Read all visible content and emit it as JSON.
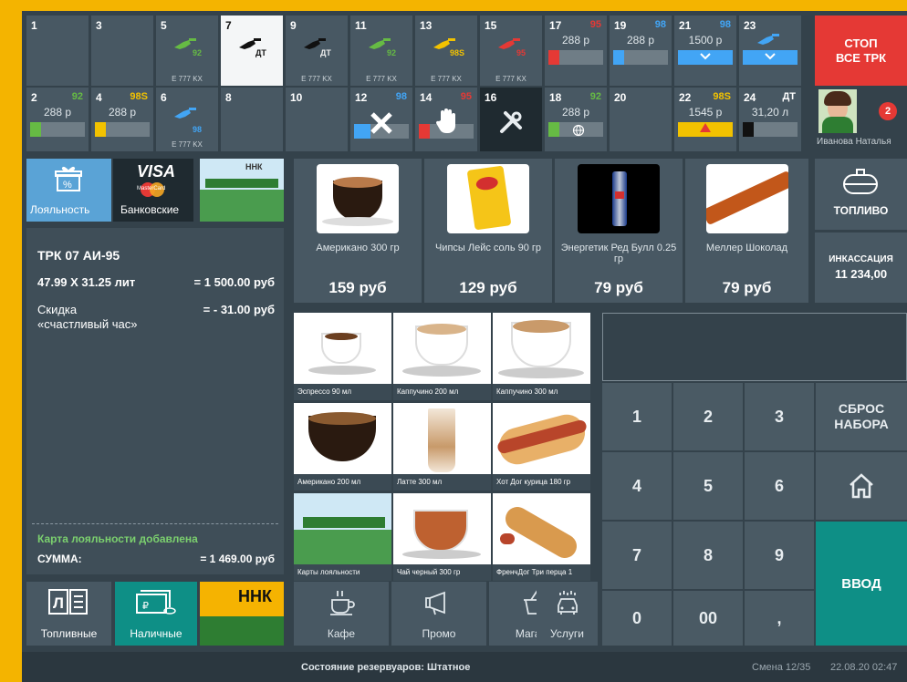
{
  "pumps_top": [
    {
      "num": "1"
    },
    {
      "num": "3"
    },
    {
      "num": "5",
      "plate": "E 777 KX",
      "nozzle": "92"
    },
    {
      "num": "7",
      "nozzle": "ДТ"
    },
    {
      "num": "9",
      "plate": "E 777 KX",
      "nozzle": "ДТ"
    },
    {
      "num": "11",
      "plate": "E 777 KX",
      "nozzle": "92"
    },
    {
      "num": "13",
      "plate": "E 777 KX",
      "nozzle": "98S"
    },
    {
      "num": "15",
      "plate": "E 777 KX",
      "nozzle": "95"
    },
    {
      "num": "17",
      "grade": "95",
      "price": "288 р"
    },
    {
      "num": "19",
      "grade": "98",
      "price": "288 р"
    },
    {
      "num": "21",
      "grade": "98",
      "price": "1500 р"
    },
    {
      "num": "23"
    }
  ],
  "pumps_bottom": [
    {
      "num": "2",
      "grade": "92",
      "price": "288 р"
    },
    {
      "num": "4",
      "grade": "98S",
      "price": "288 р"
    },
    {
      "num": "6",
      "plate": "E 777 KX",
      "nozzle": "98"
    },
    {
      "num": "8"
    },
    {
      "num": "10"
    },
    {
      "num": "12",
      "grade": "98"
    },
    {
      "num": "14",
      "grade": "95"
    },
    {
      "num": "16"
    },
    {
      "num": "18",
      "grade": "92",
      "price": "288 р"
    },
    {
      "num": "20"
    },
    {
      "num": "22",
      "grade": "98S",
      "price": "1545 р"
    },
    {
      "num": "24",
      "grade": "ДТ",
      "price": "31,20 л"
    }
  ],
  "stop": {
    "line1": "СТОП",
    "line2": "ВСЕ ТРК"
  },
  "operator": {
    "name": "Иванова Наталья",
    "badge": "2"
  },
  "payment": {
    "loyalty": "Лояльность",
    "bank": "Банковские",
    "visa": "VISA",
    "mastercard": "MasterCard",
    "nnk": "ННК"
  },
  "receipt": {
    "title": "ТРК 07   АИ-95",
    "line1_left": "47.99 X 31.25 лит",
    "line1_right": "= 1 500.00 руб",
    "disc_left1": "Скидка",
    "disc_left2": "«счастливый час»",
    "disc_right": "= - 31.00 руб",
    "card_added": "Карта лояльности  добавлена",
    "sum_label": "СУММА:",
    "sum_value": "= 1 469.00 руб"
  },
  "products": [
    {
      "name": "Американо 300 гр",
      "price": "159 руб"
    },
    {
      "name": "Чипсы Лейс соль 90 гр",
      "price": "129 руб"
    },
    {
      "name": "Энергетик Ред Булл 0.25 гр",
      "price": "79 руб"
    },
    {
      "name": "Меллер Шоколад",
      "price": "79 руб"
    }
  ],
  "right_panel": {
    "fuel": "ТОПЛИВО",
    "collection_label": "ИНКАССАЦИЯ",
    "collection_value": "11 234,00"
  },
  "grid": [
    "Эспрессо 90 мл",
    "Каппучино 200 мл",
    "Каппучино 300 мл",
    "Американо 200 мл",
    "Латте 300 мл",
    "Хот Дог курица 180 гр",
    "Карты лояльности",
    "Чай черный 300 гр",
    "ФренчДог Три перца 1"
  ],
  "keypad": {
    "k1": "1",
    "k2": "2",
    "k3": "3",
    "k4": "4",
    "k5": "5",
    "k6": "6",
    "k7": "7",
    "k8": "8",
    "k9": "9",
    "k0": "0",
    "k00": "00",
    "kcomma": ",",
    "reset1": "СБРОС",
    "reset2": "НАБОРА",
    "enter": "ВВОД"
  },
  "bottom_left": {
    "fuel_cards": "Топливные",
    "cash": "Наличные",
    "nnk": "ННК"
  },
  "categories": [
    "Кафе",
    "Промо",
    "Магазин",
    "Услуги"
  ],
  "status": {
    "tanks": "Состояние резервуаров: Штатное",
    "shift": "Смена 12/35",
    "datetime": "22.08.20 02:47"
  }
}
